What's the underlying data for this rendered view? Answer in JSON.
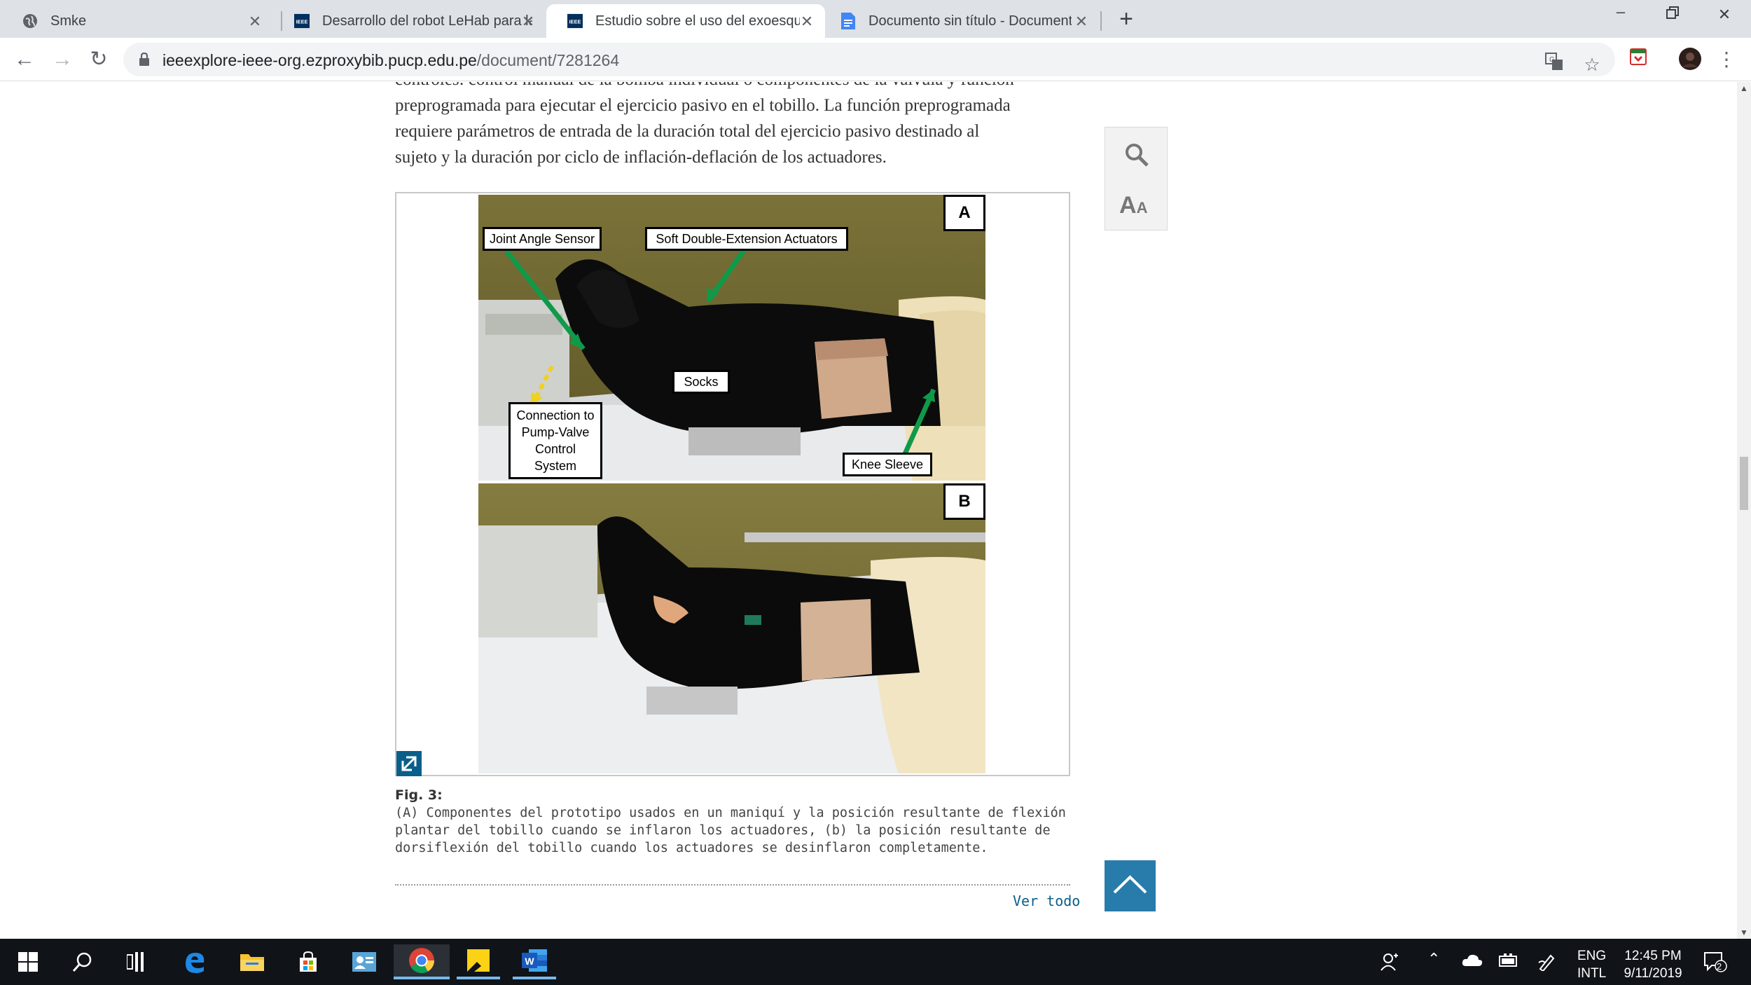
{
  "browser": {
    "tabs": [
      {
        "title": "Smke",
        "icon": "globe-icon",
        "active": false
      },
      {
        "title": "Desarrollo del robot LeHab para la",
        "icon": "ieee-icon",
        "active": false
      },
      {
        "title": "Estudio sobre el uso del exoesqueleto",
        "icon": "ieee-icon",
        "active": true
      },
      {
        "title": "Documento sin título - Documentos",
        "icon": "docs-icon",
        "active": false
      }
    ],
    "url_host": "ieeexplore-ieee-org.ezproxybib.pucp.edu.pe",
    "url_path": "/document/7281264"
  },
  "article": {
    "line_cut": "controles: control manual de la bomba individual o componentes de la válvula y función",
    "line1": "preprogramada para ejecutar el ejercicio pasivo en el tobillo. La función preprogramada",
    "line2": "requiere parámetros de entrada de la duración total del ejercicio pasivo destinado al",
    "line3": "sujeto y la duración por ciclo de inflación-deflación de los actuadores."
  },
  "figure": {
    "panel_a": "A",
    "panel_b": "B",
    "callouts": {
      "joint_angle_sensor": "Joint Angle Sensor",
      "soft_actuators": "Soft Double-Extension Actuators",
      "socks": "Socks",
      "connection": "Connection to Pump-Valve Control System",
      "knee_sleeve": "Knee Sleeve"
    },
    "caption_label": "Fig. 3:",
    "caption_text": "(A) Componentes del prototipo usados en un maniquí y la posición resultante de flexión plantar del tobillo cuando se inflaron los actuadores, (b) la posición resultante de dorsiflexión del tobillo cuando los actuadores se desinflaron completamente.",
    "see_all": "Ver todo"
  },
  "taskbar": {
    "lang_top": "ENG",
    "lang_bottom": "INTL",
    "time": "12:45 PM",
    "date": "9/11/2019",
    "notification_count": "2"
  },
  "colors": {
    "tabbar": "#dee1e6",
    "link": "#0a5f8a",
    "scrolltop_button": "#287cab",
    "taskbar": "#101318"
  }
}
